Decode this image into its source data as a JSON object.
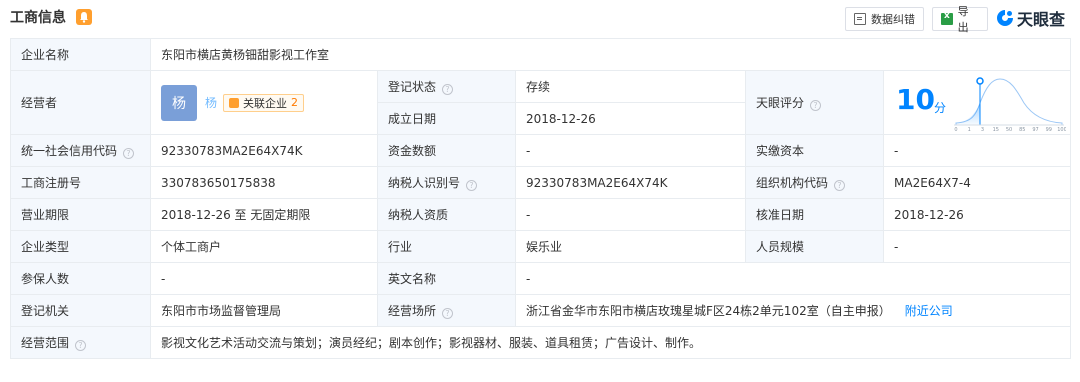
{
  "header": {
    "title": "工商信息",
    "correct_label": "数据纠错",
    "export_label": "导出",
    "brand": "天眼查"
  },
  "rows": {
    "company_name": {
      "label": "企业名称",
      "value": "东阳市横店黄杨钿甜影视工作室"
    },
    "operator": {
      "label": "经营者",
      "avatar_char": "杨",
      "name": "杨",
      "related_label": "关联企业",
      "related_count": "2"
    },
    "reg_status": {
      "label": "登记状态",
      "value": "存续"
    },
    "found_date": {
      "label": "成立日期",
      "value": "2018-12-26"
    },
    "score": {
      "label": "天眼评分",
      "value": "10",
      "unit": "分",
      "ticks": [
        "0",
        "1",
        "3",
        "15",
        "50",
        "85",
        "97",
        "99",
        "100"
      ]
    },
    "credit_code": {
      "label": "统一社会信用代码",
      "value": "92330783MA2E64X74K"
    },
    "capital": {
      "label": "资金数额",
      "value": "-"
    },
    "paid_capital": {
      "label": "实缴资本",
      "value": "-"
    },
    "reg_no": {
      "label": "工商注册号",
      "value": "330783650175838"
    },
    "taxpayer_id": {
      "label": "纳税人识别号",
      "value": "92330783MA2E64X74K"
    },
    "org_code": {
      "label": "组织机构代码",
      "value": "MA2E64X7-4"
    },
    "term": {
      "label": "营业期限",
      "value": "2018-12-26 至 无固定期限"
    },
    "taxpayer_qual": {
      "label": "纳税人资质",
      "value": "-"
    },
    "approve_date": {
      "label": "核准日期",
      "value": "2018-12-26"
    },
    "company_type": {
      "label": "企业类型",
      "value": "个体工商户"
    },
    "industry": {
      "label": "行业",
      "value": "娱乐业"
    },
    "staff_size": {
      "label": "人员规模",
      "value": "-"
    },
    "insured": {
      "label": "参保人数",
      "value": "-"
    },
    "english_name": {
      "label": "英文名称",
      "value": "-"
    },
    "reg_authority": {
      "label": "登记机关",
      "value": "东阳市市场监督管理局"
    },
    "address": {
      "label": "经营场所",
      "value": "浙江省金华市东阳市横店玫瑰星城F区24栋2单元102室（自主申报）",
      "nearby_label": "附近公司"
    },
    "scope": {
      "label": "经营范围",
      "value": "影视文化艺术活动交流与策划；演员经纪；剧本创作；影视器材、服装、道具租赁；广告设计、制作。"
    }
  },
  "colors": {
    "accent": "#0084ff",
    "status_ok": "#2c9c3f",
    "label_bg": "#f4f8fd",
    "border": "#e8ecf0",
    "bell": "#ff9f2e"
  }
}
